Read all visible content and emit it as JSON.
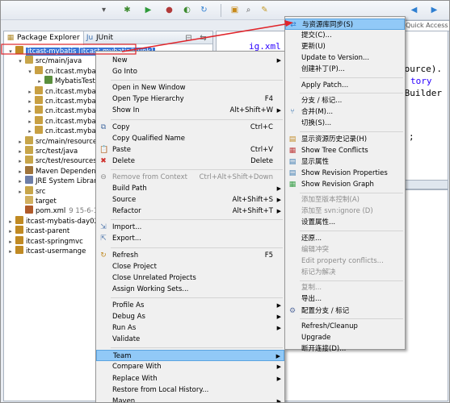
{
  "toolbar": {
    "icons": [
      "run-menu-icon",
      "debug-icon",
      "play-icon",
      "run-config-icon",
      "external-tools-icon",
      "refresh-icon",
      "open-folder-icon",
      "search-icon",
      "annotation-icon",
      "back-icon",
      "forward-icon"
    ]
  },
  "quick_access": "Quick Access",
  "tabs": [
    {
      "label": "Package Explorer"
    },
    {
      "label": "JUnit"
    }
  ],
  "tree": [
    {
      "twisty": "▾",
      "label": "itcast-mybatis [itcast-mybatis/trunk]",
      "selected": true
    },
    {
      "twisty": "▾",
      "label": "src/main/java"
    },
    {
      "twisty": "▾",
      "label": "cn.itcast.myba"
    },
    {
      "twisty": "▸",
      "label": "MybatisTest"
    },
    {
      "twisty": "▸",
      "label": "cn.itcast.myba"
    },
    {
      "twisty": "▸",
      "label": "cn.itcast.myba"
    },
    {
      "twisty": "▸",
      "label": "cn.itcast.myba"
    },
    {
      "twisty": "▸",
      "label": "cn.itcast.myba"
    },
    {
      "twisty": "▸",
      "label": "cn.itcast.myba"
    },
    {
      "twisty": "▸",
      "label": "src/main/resources"
    },
    {
      "twisty": "▸",
      "label": "src/test/java"
    },
    {
      "twisty": "▸",
      "label": "src/test/resources"
    },
    {
      "twisty": "▸",
      "label": "Maven Dependence"
    },
    {
      "twisty": "▸",
      "label": "JRE System Library"
    },
    {
      "twisty": "▸",
      "label": "src"
    },
    {
      "twisty": "",
      "label": "target"
    },
    {
      "twisty": "",
      "label": "pom.xml",
      "extra": "9  15-6-18"
    },
    {
      "twisty": "▸",
      "label": "itcast-mybatis-day02"
    },
    {
      "twisty": "▸",
      "label": "itcast-parent"
    },
    {
      "twisty": "▸",
      "label": "itcast-springmvc"
    },
    {
      "twisty": "▸",
      "label": "itcast-usermange"
    }
  ],
  "editor": {
    "lines": [
      "ig.xml",
      "source).",
      "tory",
      "yBuilder",
      ";"
    ]
  },
  "context_menu": [
    {
      "label": "New",
      "shortcut": "",
      "arrow": true,
      "icon": ""
    },
    {
      "label": "Go Into",
      "shortcut": "",
      "arrow": false,
      "icon": ""
    },
    {
      "sep": true
    },
    {
      "label": "Open in New Window",
      "shortcut": "",
      "arrow": false,
      "icon": ""
    },
    {
      "label": "Open Type Hierarchy",
      "shortcut": "F4",
      "arrow": false,
      "icon": ""
    },
    {
      "label": "Show In",
      "shortcut": "Alt+Shift+W",
      "arrow": true,
      "icon": ""
    },
    {
      "sep": true
    },
    {
      "label": "Copy",
      "shortcut": "Ctrl+C",
      "arrow": false,
      "icon": "copy-icon"
    },
    {
      "label": "Copy Qualified Name",
      "shortcut": "",
      "arrow": false,
      "icon": ""
    },
    {
      "label": "Paste",
      "shortcut": "Ctrl+V",
      "arrow": false,
      "icon": "paste-icon"
    },
    {
      "label": "Delete",
      "shortcut": "Delete",
      "arrow": false,
      "icon": "delete-icon"
    },
    {
      "sep": true
    },
    {
      "label": "Remove from Context",
      "shortcut": "Ctrl+Alt+Shift+Down",
      "arrow": false,
      "icon": "remove-icon",
      "disabled": true
    },
    {
      "label": "Build Path",
      "shortcut": "",
      "arrow": true,
      "icon": ""
    },
    {
      "label": "Source",
      "shortcut": "Alt+Shift+S",
      "arrow": true,
      "icon": ""
    },
    {
      "label": "Refactor",
      "shortcut": "Alt+Shift+T",
      "arrow": true,
      "icon": ""
    },
    {
      "sep": true
    },
    {
      "label": "Import...",
      "shortcut": "",
      "arrow": false,
      "icon": "import-icon"
    },
    {
      "label": "Export...",
      "shortcut": "",
      "arrow": false,
      "icon": "export-icon"
    },
    {
      "sep": true
    },
    {
      "label": "Refresh",
      "shortcut": "F5",
      "arrow": false,
      "icon": "refresh-icon"
    },
    {
      "label": "Close Project",
      "shortcut": "",
      "arrow": false,
      "icon": ""
    },
    {
      "label": "Close Unrelated Projects",
      "shortcut": "",
      "arrow": false,
      "icon": ""
    },
    {
      "label": "Assign Working Sets...",
      "shortcut": "",
      "arrow": false,
      "icon": ""
    },
    {
      "sep": true
    },
    {
      "label": "Profile As",
      "shortcut": "",
      "arrow": true,
      "icon": ""
    },
    {
      "label": "Debug As",
      "shortcut": "",
      "arrow": true,
      "icon": ""
    },
    {
      "label": "Run As",
      "shortcut": "",
      "arrow": true,
      "icon": ""
    },
    {
      "label": "Validate",
      "shortcut": "",
      "arrow": false,
      "icon": ""
    },
    {
      "sep": true
    },
    {
      "label": "Team",
      "shortcut": "",
      "arrow": true,
      "icon": "",
      "highlight": true
    },
    {
      "label": "Compare With",
      "shortcut": "",
      "arrow": true,
      "icon": ""
    },
    {
      "label": "Replace With",
      "shortcut": "",
      "arrow": true,
      "icon": ""
    },
    {
      "label": "Restore from Local History...",
      "shortcut": "",
      "arrow": false,
      "icon": ""
    },
    {
      "label": "Maven",
      "shortcut": "",
      "arrow": true,
      "icon": ""
    }
  ],
  "team_menu": [
    {
      "label": "与资源库同步(S)",
      "icon": "sync-icon",
      "highlight": true
    },
    {
      "label": "提交(C)...",
      "icon": ""
    },
    {
      "label": "更新(U)",
      "icon": ""
    },
    {
      "label": "Update to Version...",
      "icon": ""
    },
    {
      "label": "创建补丁(P)...",
      "icon": ""
    },
    {
      "sep": true
    },
    {
      "label": "Apply Patch...",
      "icon": ""
    },
    {
      "sep": true
    },
    {
      "label": "分支 / 标记...",
      "icon": ""
    },
    {
      "label": "合并(M)...",
      "icon": "merge-icon"
    },
    {
      "label": "切换(S)...",
      "icon": ""
    },
    {
      "sep": true
    },
    {
      "label": "显示资源历史记录(H)",
      "icon": "history-icon"
    },
    {
      "label": "Show Tree Conflicts",
      "icon": "tree-conflicts-icon"
    },
    {
      "label": "显示属性",
      "icon": "properties-icon"
    },
    {
      "label": "Show Revision Properties",
      "icon": "revision-properties-icon"
    },
    {
      "label": "Show Revision Graph",
      "icon": "revision-graph-icon"
    },
    {
      "sep": true
    },
    {
      "label": "添加至版本控制(A)",
      "icon": "",
      "disabled": true
    },
    {
      "label": "添加至 svn:ignore (D)",
      "icon": "",
      "disabled": true
    },
    {
      "label": "设置属性...",
      "icon": ""
    },
    {
      "sep": true
    },
    {
      "label": "还原...",
      "icon": ""
    },
    {
      "label": "编辑冲突",
      "icon": "",
      "disabled": true
    },
    {
      "label": "Edit property conflicts...",
      "icon": "",
      "disabled": true
    },
    {
      "label": "标记为解决",
      "icon": "",
      "disabled": true
    },
    {
      "sep": true
    },
    {
      "label": "复制...",
      "icon": "",
      "disabled": true
    },
    {
      "label": "导出...",
      "icon": ""
    },
    {
      "label": "配置分支 / 标记",
      "icon": "branch-config-icon"
    },
    {
      "sep": true
    },
    {
      "label": "Refresh/Cleanup",
      "icon": ""
    },
    {
      "label": "Upgrade",
      "icon": ""
    },
    {
      "label": "断开连接(D)...",
      "icon": ""
    }
  ],
  "colors": {
    "selection": "#3875d7",
    "menu_highlight": "#91c9f7",
    "annotation_arrow": "#e0242a",
    "code_blue": "#2a00ff"
  }
}
